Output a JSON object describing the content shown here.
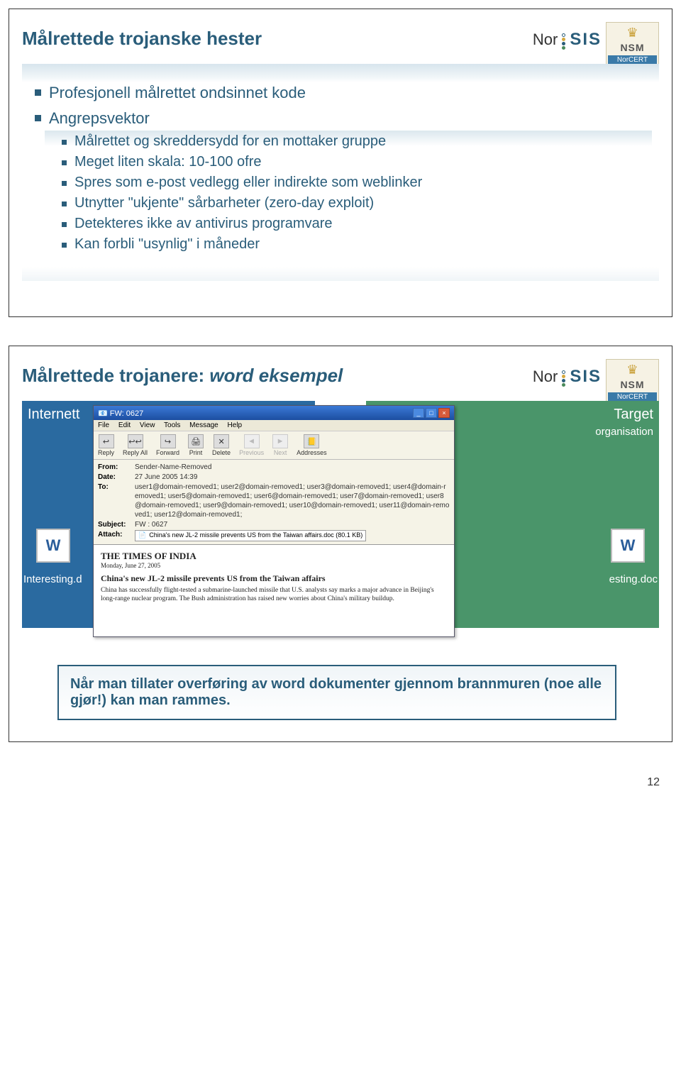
{
  "brand": {
    "nor": "Nor",
    "sis": "SIS"
  },
  "nsm": {
    "label": "NSM",
    "sub": "NorCERT"
  },
  "slide1": {
    "title": "Målrettede trojanske hester",
    "b1": "Profesjonell målrettet ondsinnet kode",
    "b2": "Angrepsvektor",
    "sub": [
      "Målrettet og skreddersydd for en mottaker gruppe",
      "Meget liten skala: 10-100 ofre",
      "Spres som e-post vedlegg eller indirekte som weblinker",
      "Utnytter \"ukjente\" sårbarheter (zero-day exploit)",
      "Detekteres ikke av antivirus programvare",
      "Kan forbli \"usynlig\" i måneder"
    ]
  },
  "slide2": {
    "title_a": "Målrettede trojanere: ",
    "title_b": "word eksempel",
    "left_header": "Internett",
    "right_header": "Target",
    "right_sub": "organisation",
    "file_left": "Interesting.d",
    "file_right": "esting.doc",
    "email": {
      "title": "FW: 0627",
      "menu": [
        "File",
        "Edit",
        "View",
        "Tools",
        "Message",
        "Help"
      ],
      "tools": [
        "Reply",
        "Reply All",
        "Forward",
        "Print",
        "Delete",
        "Previous",
        "Next",
        "Addresses"
      ],
      "from": "Sender-Name-Removed",
      "date": "27 June 2005 14:39",
      "to": "user1@domain-removed1; user2@domain-removed1; user3@domain-removed1; user4@domain-removed1; user5@domain-removed1; user6@domain-removed1; user7@domain-removed1; user8@domain-removed1; user9@domain-removed1; user10@domain-removed1; user11@domain-removed1; user12@domain-removed1;",
      "subject": "FW : 0627",
      "attach": "China's new JL-2 missile prevents US from the Taiwan affairs.doc (80.1 KB)",
      "paper_title": "THE TIMES OF INDIA",
      "paper_date": "Monday, June 27, 2005",
      "headline": "China's new JL-2 missile prevents US from the Taiwan affairs",
      "article": "China has successfully flight-tested a submarine-launched missile that U.S. analysts say marks a major advance in Beijing's long-range nuclear program. The Bush administration has raised new worries about China's military buildup."
    },
    "callout": "Når man tillater overføring av word dokumenter gjennom brannmuren (noe alle gjør!) kan man rammes."
  },
  "page_number": "12"
}
